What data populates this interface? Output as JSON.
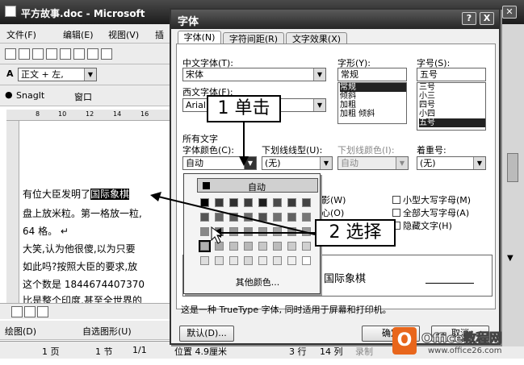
{
  "word": {
    "title": "平方故事.doc - Microsoft",
    "menu": [
      "文件(F)",
      "编辑(E)",
      "视图(V)",
      "插"
    ],
    "style_box": "正文 + 左,",
    "snagit": "SnagIt",
    "window_label": "窗口",
    "ruler_marks": [
      "8",
      "10",
      "12",
      "14",
      "16"
    ],
    "doc_lines": [
      "有位大臣发明了",
      "盘上放米粒。第一格放一粒,",
      "64 格。 ↵",
      "大笑,认为他很傻,以为只要",
      "如此吗?按照大臣的要求,放",
      "这个数是 1844674407370",
      "比是整个印度,甚至全世界的"
    ],
    "highlight_word": "国际象棋",
    "drawing_bar": [
      "绘图(D)",
      "自选图形(U)"
    ],
    "status": [
      "1 页",
      "1 节",
      "1/1",
      "位置 4.9厘米",
      "3 行",
      "14 列",
      "录制"
    ]
  },
  "dialog": {
    "title": "字体",
    "tabs": [
      "字体(N)",
      "字符间距(R)",
      "文字效果(X)"
    ],
    "chinese_font_label": "中文字体(T):",
    "chinese_font_value": "宋体",
    "western_font_label": "西文字体(F):",
    "western_font_value": "Arial",
    "style_label": "字形(Y):",
    "style_value": "常规",
    "style_list": [
      "常规",
      "倾斜",
      "加粗",
      "加粗 倾斜"
    ],
    "size_label": "字号(S):",
    "size_value": "五号",
    "size_list": [
      "三号",
      "小三",
      "四号",
      "小四",
      "五号"
    ],
    "all_text_label": "所有文字",
    "font_color_label": "字体颜色(C):",
    "font_color_value": "自动",
    "underline_label": "下划线线型(U):",
    "underline_value": "(无)",
    "underline_color_label": "下划线颜色(I):",
    "underline_color_value": "自动",
    "emphasis_label": "着重号:",
    "emphasis_value": "(无)",
    "effects": [
      "影(W)",
      "心(O)",
      "小型大写字母(M)",
      "全部大写字母(A)",
      "隐藏文字(H)"
    ],
    "preview_text": "国际象棋",
    "truetype_note": "这是一种 TrueType 字体, 同时适用于屏幕和打印机。",
    "default_button": "默认(D)...",
    "ok_button": "确定",
    "cancel_button": "取消",
    "help_button": "?",
    "close_button": "X"
  },
  "palette": {
    "auto_label": "自动",
    "more_colors": "其他颜色...",
    "rows": [
      [
        "#000000",
        "#3a3a3a",
        "#2e2e2e",
        "#3c3c3c",
        "#1e1e1e",
        "#4a4a4a",
        "#3a3a3a",
        "#444444"
      ],
      [
        "#555555",
        "#666666",
        "#5a5a5a",
        "#6a6a6a",
        "#505050",
        "#707070",
        "#606060",
        "#777777"
      ],
      [
        "#888888",
        "#7a7a7a",
        "#969696",
        "#8a8a8a",
        "#9a9a9a",
        "#a0a0a0",
        "#909090",
        "#999999"
      ],
      [
        "#b0b0b0",
        "#a8a8a8",
        "#c0c0c0",
        "#b8b8b8",
        "#c8c8c8",
        "#bcbcbc",
        "#cccccc",
        "#d0d0d0"
      ],
      [
        "#dddddd",
        "#e0e0e0",
        "#e6e6e6",
        "#d8d8d8",
        "#eaeaea",
        "#e4e4e4",
        "#f0f0f0",
        "#ffffff"
      ]
    ]
  },
  "callouts": {
    "step1": "1 单击",
    "step2": "2 选择"
  },
  "watermark": {
    "brand": "Office教程网",
    "url": "www.office26.com"
  }
}
